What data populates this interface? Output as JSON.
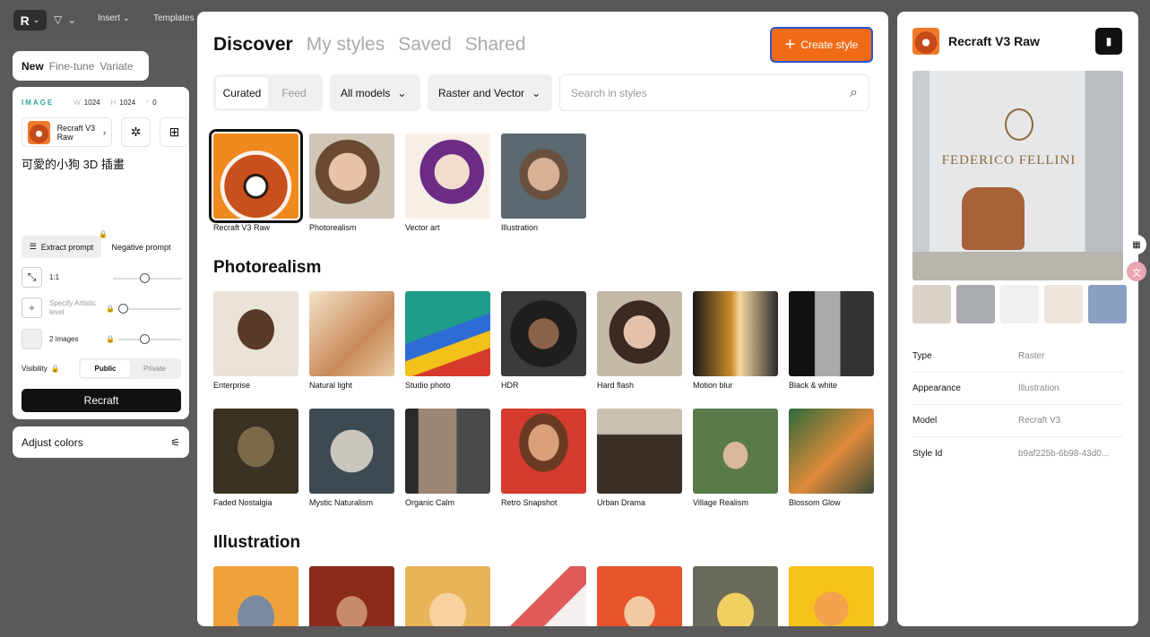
{
  "toolbar": {
    "menus": [
      "Insert",
      "Templates"
    ]
  },
  "left": {
    "tabs": [
      "New",
      "Fine-tune",
      "Variate"
    ],
    "image_label": "IMAGE",
    "w_label": "W",
    "w_value": "1024",
    "h_label": "H",
    "h_value": "1024",
    "seed_value": "0",
    "model_name": "Recraft V3 Raw",
    "prompt": "可愛的小狗 3D 插畫",
    "extract_prompt": "Extract prompt",
    "negative_prompt": "Negative prompt",
    "ratio": "1:1",
    "artistic_level": "Specify Artistic level",
    "images": "2 images",
    "visibility": "Visibility",
    "public": "Public",
    "private": "Private",
    "recraft_button": "Recraft",
    "adjust_colors": "Adjust colors"
  },
  "main": {
    "tabs": [
      "Discover",
      "My styles",
      "Saved",
      "Shared"
    ],
    "create_style": "Create style",
    "filter_seg": [
      "Curated",
      "Feed"
    ],
    "model_filter": "All models",
    "type_filter": "Raster and Vector",
    "search_placeholder": "Search in styles",
    "featured": [
      "Recraft V3 Raw",
      "Photorealism",
      "Vector art",
      "Illustration"
    ],
    "photorealism_title": "Photorealism",
    "photo_row1": [
      "Enterprise",
      "Natural light",
      "Studio photo",
      "HDR",
      "Hard flash",
      "Motion blur",
      "Black & white"
    ],
    "photo_row2": [
      "Faded Nostalgia",
      "Mystic Naturalism",
      "Organic Calm",
      "Retro Snapshot",
      "Urban Drama",
      "Village Realism",
      "Blossom Glow"
    ],
    "illustration_title": "Illustration"
  },
  "right": {
    "title": "Recraft V3 Raw",
    "hero_brand": "FEDERICO FELLINI",
    "props": [
      {
        "key": "Type",
        "value": "Raster"
      },
      {
        "key": "Appearance",
        "value": "Illustration"
      },
      {
        "key": "Model",
        "value": "Recraft V3"
      },
      {
        "key": "Style Id",
        "value": "b9af225b-6b98-43d0..."
      }
    ]
  },
  "colors": {
    "accent": "#f16b17",
    "focus": "#2a56d4",
    "teal": "#2aa69d"
  }
}
